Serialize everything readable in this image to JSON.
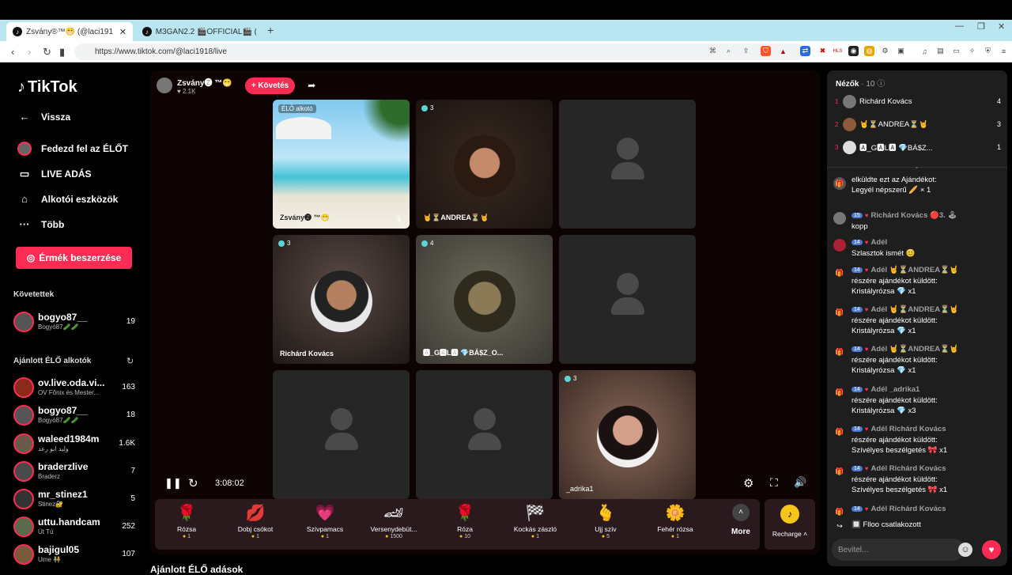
{
  "browser": {
    "tabs": [
      {
        "title": "Zsvány®™😁 (@laci1918) É...",
        "active": true
      },
      {
        "title": "M3GAN2.2 🎬OFFICIAL🎬 (@m3gan",
        "active": false
      }
    ],
    "url": "https://www.tiktok.com/@laci1918/live"
  },
  "sidebar": {
    "logo": "TikTok",
    "nav": [
      {
        "icon": "back-arrow-icon",
        "label": "Vissza"
      },
      {
        "icon": "live-avatar-icon",
        "label": "Fedezd fel az ÉLŐT"
      },
      {
        "icon": "camera-icon",
        "label": "LIVE ADÁS"
      },
      {
        "icon": "house-icon",
        "label": "Alkotói eszközök"
      },
      {
        "icon": "more-dots-icon",
        "label": "Több"
      }
    ],
    "coins_button": "Érmék beszerzése",
    "following_header": "Követettek",
    "following": [
      {
        "name": "bogyo87__",
        "sub": "Bogyó87🥒🥒",
        "count": "19"
      }
    ],
    "recommended_header": "Ajánlott ÉLŐ alkotók",
    "recommended": [
      {
        "name": "ov.live.oda.vi...",
        "sub": "OV Főnix és Mester...",
        "count": "163"
      },
      {
        "name": "bogyo87__",
        "sub": "Bogyó87🥒🥒",
        "count": "18"
      },
      {
        "name": "waleed1984m",
        "sub": "وليد ابو رعد",
        "count": "1.6K"
      },
      {
        "name": "braderzlive",
        "sub": "Braderz",
        "count": "7"
      },
      {
        "name": "mr_stinez1",
        "sub": "Stinez🔐",
        "count": "5"
      },
      {
        "name": "uttu.handcam",
        "sub": "Út Tú",
        "count": "252"
      },
      {
        "name": "bajigul05",
        "sub": "Ume 🧑‍🤝‍🧑",
        "count": "107"
      }
    ]
  },
  "stream": {
    "host_name": "Zsvány🅩 ™😁",
    "host_likes": "♥ 2.1K",
    "follow_button": "+ Követés",
    "cells": [
      {
        "badge": "ÉLŐ alkotó",
        "name": "Zsvány🅩 ™😁",
        "kind": "beach"
      },
      {
        "badge": "3",
        "name": "🤘⏳ANDREA⏳🤘",
        "kind": "photo",
        "color": "#6b3a2a"
      },
      {
        "badge": "",
        "name": "",
        "kind": "empty"
      },
      {
        "badge": "3",
        "name": "Richárd Kovács",
        "kind": "photo",
        "color": "#5a4a45"
      },
      {
        "badge": "4",
        "name": "🅰_G🅰L🅰 💎BÁ$Z_O...",
        "kind": "photo",
        "color": "#5c5a4a"
      },
      {
        "badge": "",
        "name": "",
        "kind": "empty"
      },
      {
        "badge": "",
        "name": "",
        "kind": "empty"
      },
      {
        "badge": "",
        "name": "",
        "kind": "empty"
      },
      {
        "badge": "3",
        "name": "_adrika1",
        "kind": "photo",
        "color": "#7a5a50"
      }
    ],
    "timer": "3:08:02"
  },
  "gifts": [
    {
      "icon": "🌹",
      "name": "Rózsa",
      "price": "1"
    },
    {
      "icon": "💋",
      "name": "Dobj csókot",
      "price": "1"
    },
    {
      "icon": "💗",
      "name": "Szívpamacs",
      "price": "1"
    },
    {
      "icon": "🏎",
      "name": "Versenydebüt...",
      "price": "1500"
    },
    {
      "icon": "🌹",
      "name": "Róza",
      "price": "10"
    },
    {
      "icon": "🏁",
      "name": "Kockás zászló",
      "price": "1"
    },
    {
      "icon": "🫰",
      "name": "Ujj szív",
      "price": "5"
    },
    {
      "icon": "🌼",
      "name": "Fehér rózsa",
      "price": "1"
    }
  ],
  "more_label": "More",
  "recharge_label": "Recharge ˄",
  "bottom_heading": "Ajánlott ÉLŐ adások",
  "chat": {
    "viewers_label": "Nézők",
    "viewers_count": "· 10",
    "top_viewers": [
      {
        "rank": "1",
        "name": "Richárd Kovács",
        "count": "4"
      },
      {
        "rank": "2",
        "name": "🤘⏳ANDREA⏳🤘",
        "count": "3"
      },
      {
        "rank": "3",
        "name": "🅰_G🅰L🅰 💎BÁ$Z...",
        "count": "1"
      }
    ],
    "messages": [
      {
        "avatar": "🎁",
        "level": "",
        "name": "",
        "body": "elküldte ezt az Ajándékot:\nLegyél népszerű 🥖 × 1"
      },
      {
        "avatar": "",
        "level": "15",
        "name": "Richárd Kovács 🔴3. 🕹",
        "body": "kopp"
      },
      {
        "avatar": "",
        "level": "14",
        "name": "Adél",
        "body": "Szlasztok ismét 😊"
      },
      {
        "avatar": "🎁",
        "level": "14",
        "name": "Adél 🤘⏳ANDREA⏳🤘",
        "body": "részére ajándékot küldött:\nKristályrózsa 💎 x1"
      },
      {
        "avatar": "🎁",
        "level": "14",
        "name": "Adél 🤘⏳ANDREA⏳🤘",
        "body": "részére ajándékot küldött:\nKristályrózsa 💎 x1"
      },
      {
        "avatar": "🎁",
        "level": "14",
        "name": "Adél 🤘⏳ANDREA⏳🤘",
        "body": "részére ajándékot küldött:\nKristályrózsa 💎 x1"
      },
      {
        "avatar": "🎁",
        "level": "14",
        "name": "Adél _adrika1",
        "body": "részére ajándékot küldött:\nKristályrózsa 💎 x3"
      },
      {
        "avatar": "🎁",
        "level": "14",
        "name": "Adél Richárd Kovács",
        "body": "részére ajándékot küldött:\nSzívélyes beszélgetés 🎀 x1"
      },
      {
        "avatar": "🎁",
        "level": "14",
        "name": "Adél Richárd Kovács",
        "body": "részére ajándékot küldött:\nSzívélyes beszélgetés 🎀 x1"
      },
      {
        "avatar": "🎁",
        "level": "14",
        "name": "Adél Richárd Kovács",
        "body": ""
      },
      {
        "avatar": "↪",
        "level": "",
        "name": "",
        "body": "🔲 Flloo  csatlakozott"
      }
    ],
    "input_placeholder": "Bevitel..."
  }
}
